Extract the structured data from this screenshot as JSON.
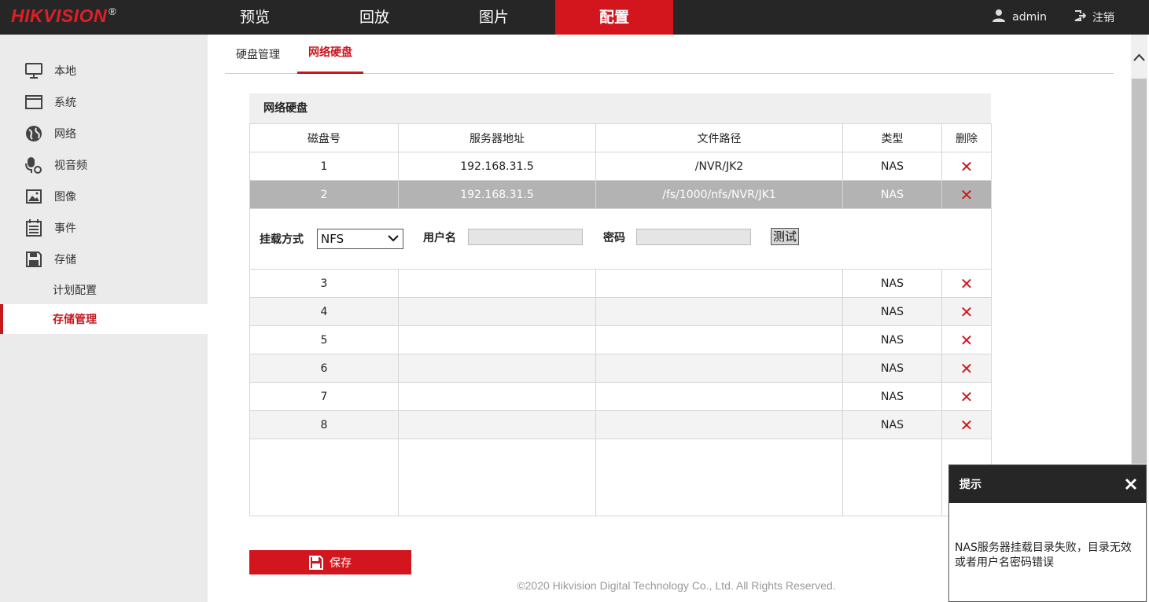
{
  "brand": {
    "logo": "HIKVISION",
    "reg": "®"
  },
  "nav": {
    "tabs": [
      "预览",
      "回放",
      "图片",
      "配置"
    ],
    "active": "配置"
  },
  "user": {
    "name": "admin",
    "logout": "注销"
  },
  "sidebar": {
    "items": [
      {
        "label": "本地",
        "icon": "monitor-icon"
      },
      {
        "label": "系统",
        "icon": "window-icon"
      },
      {
        "label": "网络",
        "icon": "globe-icon"
      },
      {
        "label": "视音频",
        "icon": "video-audio-icon"
      },
      {
        "label": "图像",
        "icon": "image-icon"
      },
      {
        "label": "事件",
        "icon": "calendar-icon"
      },
      {
        "label": "存储",
        "icon": "floppy-icon"
      }
    ],
    "sub": [
      "计划配置",
      "存储管理"
    ],
    "active_sub": "存储管理"
  },
  "subtabs": [
    "硬盘管理",
    "网络硬盘"
  ],
  "active_subtab": "网络硬盘",
  "panel": {
    "title": "网络硬盘",
    "columns": [
      "磁盘号",
      "服务器地址",
      "文件路径",
      "类型",
      "删除"
    ],
    "rows": [
      {
        "no": "1",
        "addr": "192.168.31.5",
        "path": "/NVR/JK2",
        "type": "NAS"
      },
      {
        "no": "2",
        "addr": "192.168.31.5",
        "path": "/fs/1000/nfs/NVR/JK1",
        "type": "NAS"
      },
      {
        "no": "3",
        "addr": "",
        "path": "",
        "type": "NAS"
      },
      {
        "no": "4",
        "addr": "",
        "path": "",
        "type": "NAS"
      },
      {
        "no": "5",
        "addr": "",
        "path": "",
        "type": "NAS"
      },
      {
        "no": "6",
        "addr": "",
        "path": "",
        "type": "NAS"
      },
      {
        "no": "7",
        "addr": "",
        "path": "",
        "type": "NAS"
      },
      {
        "no": "8",
        "addr": "",
        "path": "",
        "type": "NAS"
      }
    ],
    "selected_row": "2",
    "delete_glyph": "✕",
    "mount": {
      "method_label": "挂载方式",
      "method_value": "NFS",
      "username_label": "用户名",
      "username_value": "",
      "password_label": "密码",
      "password_value": "",
      "test_label": "测试"
    }
  },
  "save_label": "保存",
  "footer": "©2020 Hikvision Digital Technology Co., Ltd. All Rights Reserved.",
  "tip": {
    "title": "提示",
    "message": "NAS服务器挂载目录失败，目录无效或者用户名密码错误"
  },
  "colors": {
    "accent": "#d3161e",
    "topbar": "#262626",
    "sidebar": "#ebebeb"
  }
}
